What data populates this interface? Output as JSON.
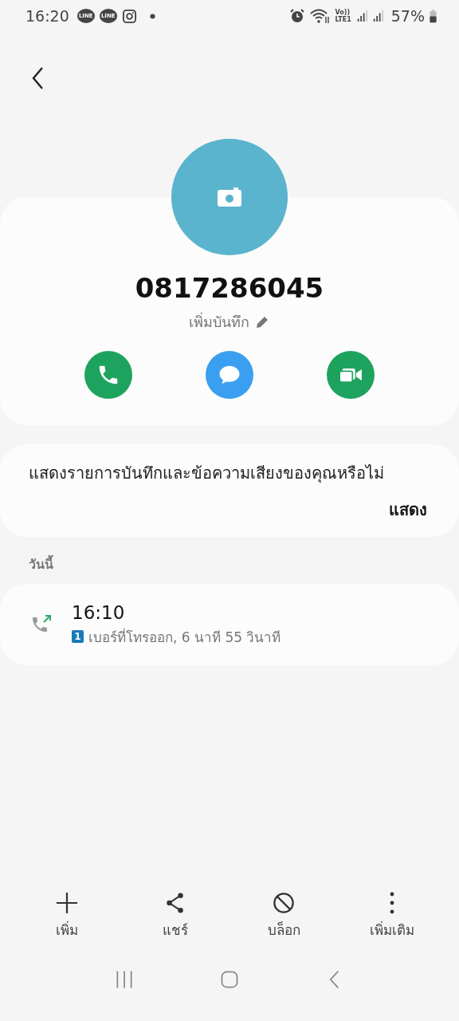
{
  "status_bar": {
    "time": "16:20",
    "notifications": [
      "LINE",
      "LINE"
    ],
    "volte": "Vo))",
    "network": "LTE1",
    "battery": "57%"
  },
  "contact": {
    "number": "0817286045",
    "note_action": "เพิ่มบันทึก"
  },
  "actions": [
    {
      "kind": "call"
    },
    {
      "kind": "message"
    },
    {
      "kind": "video"
    }
  ],
  "prompt": {
    "text": "แสดงรายการบันทึกและข้อความเสียงของคุณหรือไม่",
    "button": "แสดง"
  },
  "history": {
    "heading": "วันนี้",
    "entries": [
      {
        "time": "16:10",
        "sim": "1",
        "detail": "เบอร์ที่โทรออก, 6 นาที 55 วินาที"
      }
    ]
  },
  "toolbar": [
    {
      "kind": "add",
      "label": "เพิ่ม"
    },
    {
      "kind": "share",
      "label": "แชร์"
    },
    {
      "kind": "block",
      "label": "บล็อก"
    },
    {
      "kind": "more",
      "label": "เพิ่มเติม"
    }
  ]
}
